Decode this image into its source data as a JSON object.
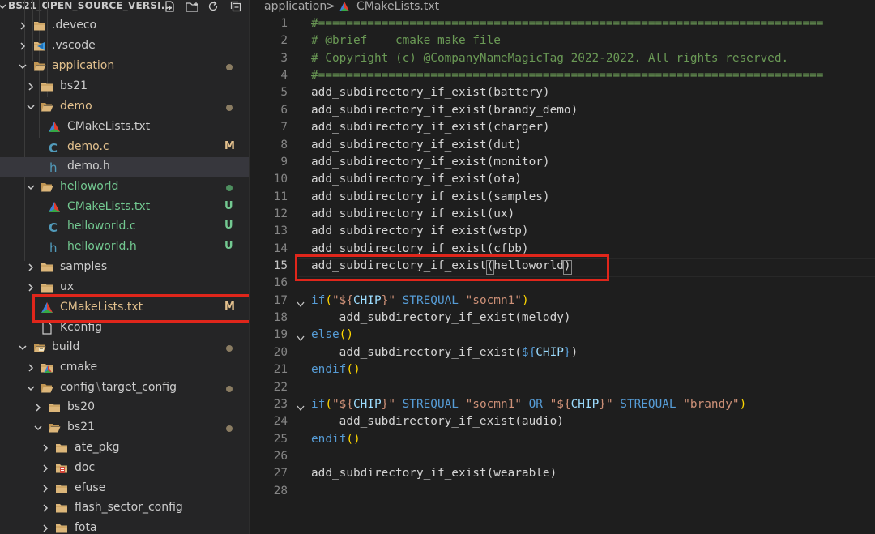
{
  "explorer": {
    "title": "BS21_OPEN_SOURCE_VERSI...",
    "toolbar_icons": [
      "new-file-icon",
      "new-folder-icon",
      "refresh-icon",
      "collapse-all-icon"
    ],
    "items": [
      {
        "label": "BS21_OPEN_SOURCE_VERSI...",
        "type": "root"
      },
      {
        "label": ".deveco",
        "type": "folder",
        "expanded": false
      },
      {
        "label": ".vscode",
        "type": "folder-vscode",
        "expanded": false
      },
      {
        "label": "application",
        "type": "folder",
        "expanded": true,
        "status": "modified-dot"
      },
      {
        "label": "bs21",
        "type": "folder",
        "expanded": false
      },
      {
        "label": "demo",
        "type": "folder",
        "expanded": true,
        "status": "modified-dot"
      },
      {
        "label": "CMakeLists.txt",
        "type": "cmake-file"
      },
      {
        "label": "demo.c",
        "type": "c-file",
        "badge": "M"
      },
      {
        "label": "demo.h",
        "type": "h-file",
        "selected": true
      },
      {
        "label": "helloworld",
        "type": "folder",
        "expanded": true,
        "status": "untracked-dot"
      },
      {
        "label": "CMakeLists.txt",
        "type": "cmake-file",
        "badge": "U"
      },
      {
        "label": "helloworld.c",
        "type": "c-file",
        "badge": "U"
      },
      {
        "label": "helloworld.h",
        "type": "h-file",
        "badge": "U"
      },
      {
        "label": "samples",
        "type": "folder",
        "expanded": false
      },
      {
        "label": "ux",
        "type": "folder",
        "expanded": false
      },
      {
        "label": "CMakeLists.txt",
        "type": "cmake-file",
        "badge": "M",
        "highlighted": true
      },
      {
        "label": "Kconfig",
        "type": "plain-file"
      },
      {
        "label": "build",
        "type": "folder-build",
        "expanded": true,
        "status": "modified-dot"
      },
      {
        "label": "cmake",
        "type": "folder-cmake",
        "expanded": false
      },
      {
        "label": "config",
        "label_sep": "\\",
        "label_tail": "target_config",
        "type": "folder",
        "expanded": true,
        "status": "modified-dot"
      },
      {
        "label": "bs20",
        "type": "folder",
        "expanded": false
      },
      {
        "label": "bs21",
        "type": "folder",
        "expanded": true,
        "status": "modified-dot"
      },
      {
        "label": "ate_pkg",
        "type": "folder",
        "expanded": false
      },
      {
        "label": "doc",
        "type": "folder-doc",
        "expanded": false
      },
      {
        "label": "efuse",
        "type": "folder",
        "expanded": false
      },
      {
        "label": "flash_sector_config",
        "type": "folder",
        "expanded": false
      },
      {
        "label": "fota",
        "type": "folder",
        "expanded": false
      }
    ]
  },
  "breadcrumb": {
    "folder": "application",
    "separator": ">",
    "file": "CMakeLists.txt"
  },
  "editor": {
    "current_line": 15,
    "lines": [
      {
        "n": "1",
        "tokens": [
          [
            "c",
            "#========================================================================"
          ]
        ]
      },
      {
        "n": "2",
        "tokens": [
          [
            "c",
            "# @brief    cmake make file"
          ]
        ]
      },
      {
        "n": "3",
        "tokens": [
          [
            "c",
            "# Copyright (c) @CompanyNameMagicTag 2022-2022. All rights reserved."
          ]
        ]
      },
      {
        "n": "4",
        "tokens": [
          [
            "c",
            "#========================================================================"
          ]
        ]
      },
      {
        "n": "5",
        "tokens": [
          [
            "p",
            "add_subdirectory_if_exist(battery)"
          ]
        ]
      },
      {
        "n": "6",
        "tokens": [
          [
            "p",
            "add_subdirectory_if_exist(brandy_demo)"
          ]
        ]
      },
      {
        "n": "7",
        "tokens": [
          [
            "p",
            "add_subdirectory_if_exist(charger)"
          ]
        ]
      },
      {
        "n": "8",
        "tokens": [
          [
            "p",
            "add_subdirectory_if_exist(dut)"
          ]
        ]
      },
      {
        "n": "9",
        "tokens": [
          [
            "p",
            "add_subdirectory_if_exist(monitor)"
          ]
        ]
      },
      {
        "n": "10",
        "tokens": [
          [
            "p",
            "add_subdirectory_if_exist(ota)"
          ]
        ]
      },
      {
        "n": "11",
        "tokens": [
          [
            "p",
            "add_subdirectory_if_exist(samples)"
          ]
        ]
      },
      {
        "n": "12",
        "tokens": [
          [
            "p",
            "add_subdirectory_if_exist(ux)"
          ]
        ]
      },
      {
        "n": "13",
        "tokens": [
          [
            "p",
            "add_subdirectory_if_exist(wstp)"
          ]
        ]
      },
      {
        "n": "14",
        "tokens": [
          [
            "p",
            "add_subdirectory_if_exist(cfbb)"
          ]
        ]
      },
      {
        "n": "15",
        "tokens": [
          [
            "p",
            "add_subdirectory_if_exist(helloworld)"
          ]
        ]
      },
      {
        "n": "16",
        "tokens": []
      },
      {
        "n": "17",
        "fold": true,
        "tokens": [
          [
            "k",
            "if"
          ],
          [
            "y",
            "("
          ],
          [
            "s",
            "\"${"
          ],
          [
            "v",
            "CHIP"
          ],
          [
            "s",
            "}\""
          ],
          [
            "p",
            " "
          ],
          [
            "k",
            "STREQUAL"
          ],
          [
            "p",
            " "
          ],
          [
            "s",
            "\"socmn1\""
          ],
          [
            "y",
            ")"
          ]
        ]
      },
      {
        "n": "18",
        "tokens": [
          [
            "p",
            "    add_subdirectory_if_exist(melody)"
          ]
        ]
      },
      {
        "n": "19",
        "fold": true,
        "tokens": [
          [
            "k",
            "else"
          ],
          [
            "y",
            "()"
          ]
        ]
      },
      {
        "n": "20",
        "tokens": [
          [
            "p",
            "    add_subdirectory_if_exist("
          ],
          [
            "k",
            "${"
          ],
          [
            "v",
            "CHIP"
          ],
          [
            "k",
            "}"
          ],
          [
            "p",
            ")"
          ]
        ]
      },
      {
        "n": "21",
        "tokens": [
          [
            "k",
            "endif"
          ],
          [
            "y",
            "()"
          ]
        ]
      },
      {
        "n": "22",
        "tokens": []
      },
      {
        "n": "23",
        "fold": true,
        "tokens": [
          [
            "k",
            "if"
          ],
          [
            "y",
            "("
          ],
          [
            "s",
            "\"${"
          ],
          [
            "v",
            "CHIP"
          ],
          [
            "s",
            "}\""
          ],
          [
            "p",
            " "
          ],
          [
            "k",
            "STREQUAL"
          ],
          [
            "p",
            " "
          ],
          [
            "s",
            "\"socmn1\""
          ],
          [
            "p",
            " "
          ],
          [
            "k",
            "OR"
          ],
          [
            "p",
            " "
          ],
          [
            "s",
            "\"${"
          ],
          [
            "v",
            "CHIP"
          ],
          [
            "s",
            "}\""
          ],
          [
            "p",
            " "
          ],
          [
            "k",
            "STREQUAL"
          ],
          [
            "p",
            " "
          ],
          [
            "s",
            "\"brandy\""
          ],
          [
            "y",
            ")"
          ]
        ]
      },
      {
        "n": "24",
        "tokens": [
          [
            "p",
            "    add_subdirectory_if_exist(audio)"
          ]
        ]
      },
      {
        "n": "25",
        "tokens": [
          [
            "k",
            "endif"
          ],
          [
            "y",
            "()"
          ]
        ]
      },
      {
        "n": "26",
        "tokens": []
      },
      {
        "n": "27",
        "tokens": [
          [
            "p",
            "add_subdirectory_if_exist(wearable)"
          ]
        ]
      },
      {
        "n": "28",
        "tokens": []
      }
    ]
  },
  "colors": {
    "modified": "#e2c08d",
    "untracked": "#73c991",
    "annotation_red": "#e0261b",
    "comment": "#6a9955",
    "keyword": "#569cd6",
    "string": "#ce9178",
    "variable": "#9cdcfe"
  }
}
